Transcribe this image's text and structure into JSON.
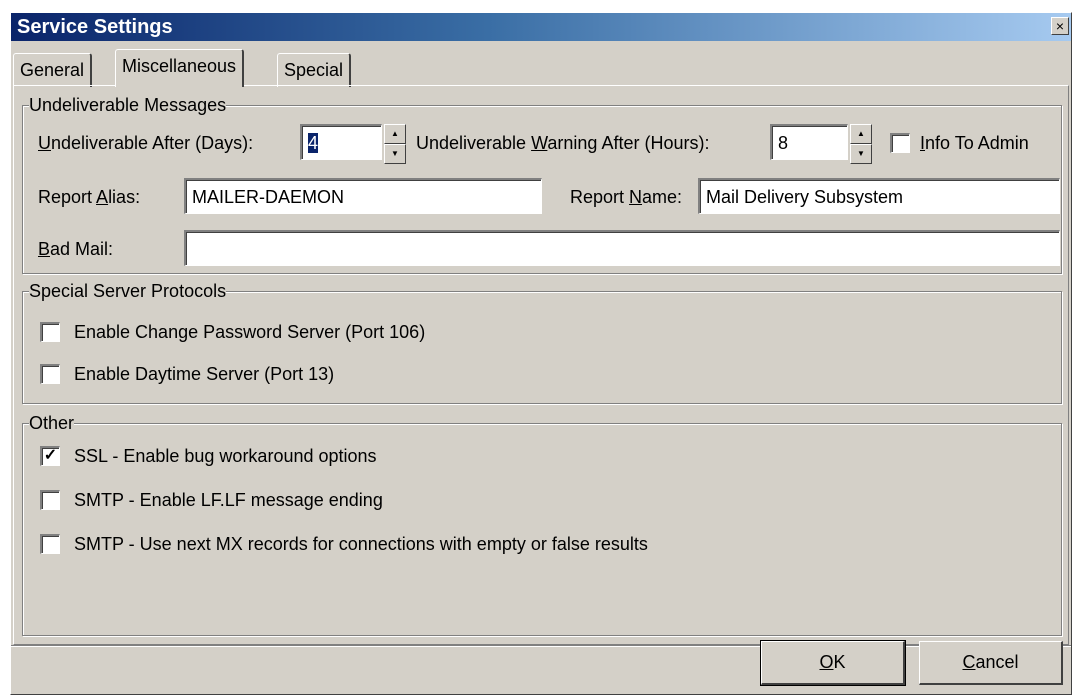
{
  "window": {
    "title": "Service Settings",
    "close_label": "×"
  },
  "tabs": [
    {
      "label": "General",
      "active": false
    },
    {
      "label": "Miscellaneous",
      "active": true
    },
    {
      "label": "Special",
      "active": false
    }
  ],
  "undeliverable": {
    "legend": "Undeliverable Messages",
    "after_days": {
      "label_pre": "",
      "label_key": "U",
      "label_post": "ndeliverable After (Days):",
      "value": "4"
    },
    "warning_hours": {
      "label_pre": "Undeliverable ",
      "label_key": "W",
      "label_post": "arning After (Hours):",
      "value": "8"
    },
    "info_to_admin": {
      "label_key": "I",
      "label_post": "nfo To Admin",
      "checked": false
    },
    "report_alias": {
      "label_pre": "Report ",
      "label_key": "A",
      "label_post": "lias:",
      "value": "MAILER-DAEMON"
    },
    "report_name": {
      "label_pre": "Report ",
      "label_key": "N",
      "label_post": "ame:",
      "value": "Mail Delivery Subsystem"
    },
    "bad_mail": {
      "label_key": "B",
      "label_post": "ad Mail:",
      "value": ""
    }
  },
  "protocols": {
    "legend": "Special Server Protocols",
    "items": [
      {
        "label": "Enable Change Password Server (Port 106)",
        "checked": false
      },
      {
        "label": "Enable Daytime Server (Port 13)",
        "checked": false
      }
    ]
  },
  "other": {
    "legend": "Other",
    "items": [
      {
        "label": "SSL - Enable bug workaround options",
        "checked": true
      },
      {
        "label": "SMTP - Enable LF.LF message ending",
        "checked": false
      },
      {
        "label": "SMTP - Use next MX records for connections with empty or false results",
        "checked": false
      }
    ]
  },
  "buttons": {
    "ok": {
      "label_key": "O",
      "label_post": "K"
    },
    "cancel": {
      "label_key": "C",
      "label_post": "ancel"
    }
  },
  "icons": {
    "spin_up": "spin-up-icon",
    "spin_down": "spin-down-icon",
    "check": "checkmark-icon"
  },
  "colors": {
    "title_start": "#0a246a",
    "title_end": "#a6caf0",
    "face": "#d4d0c8"
  }
}
